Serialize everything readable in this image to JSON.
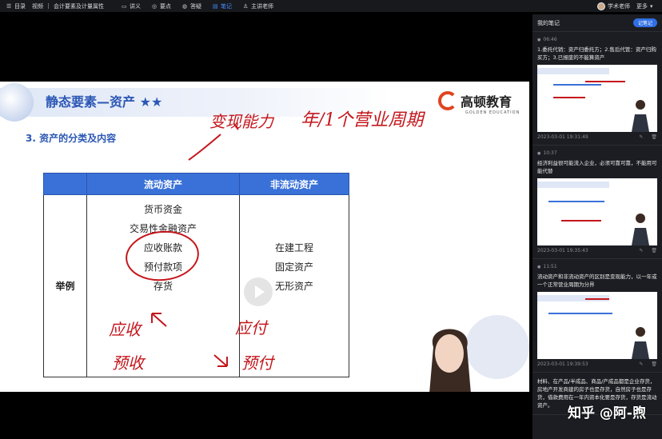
{
  "topbar": {
    "menu": "目录",
    "course": "视频",
    "chapter": "会计要素及计量属性",
    "tabs": [
      "讲义",
      "要点",
      "答疑",
      "笔记",
      "主讲老师"
    ],
    "teacher": "学术老师",
    "more": "更多"
  },
  "slide": {
    "title": "静态要素—资产",
    "stars": "★★",
    "logo": "高顿教育",
    "logo_sub": "GOLDEN EDUCATION",
    "subtitle": "3.   资产的分类及内容",
    "col1": "流动资产",
    "col2": "非流动资产",
    "row_label": "举例",
    "current_assets": [
      "货币资金",
      "交易性金融资产",
      "应收账款",
      "预付款项",
      "存货"
    ],
    "noncurrent_assets": [
      "在建工程",
      "固定资产",
      "无形资产"
    ]
  },
  "handwriting": {
    "top_left": "变现能力",
    "top_right": "年/1个营业周期",
    "bottom_1": "应收",
    "bottom_2": "应付",
    "bottom_3": "预收",
    "bottom_4": "预付"
  },
  "notes": {
    "title": "我的笔记",
    "button": "记笔记",
    "items": [
      {
        "time": "06:46",
        "text": "1.委托代销：资产归委托方；2.售后代管：资产归购买方；3.已报废的不能算资产",
        "date": "2023-03-01 19:31:49"
      },
      {
        "time": "10:37",
        "text": "经济利益很可能流入企业，必须可靠可靠，不能用可能代替",
        "date": "2023-03-01 19:35:43"
      },
      {
        "time": "11:51",
        "text": "流动资产和非流动资产的区别是变现能力，以一年或一个正常营业周期为分界",
        "date": "2023-03-01 19:39:53"
      },
      {
        "time": "",
        "text": "材料、在产品/半成品、商品/产成品都是企业存货，房地产开发商建的房子也是存货，自然房子也是存货，借款费用在一年内资本化要是存货，存货是流动资产。",
        "date": ""
      }
    ]
  },
  "watermark": "知乎 @阿-煦",
  "colors": {
    "accent": "#2f6fe4",
    "slide_blue": "#2b57b5",
    "table_head": "#3a71d8",
    "ink_red": "#c4161c"
  }
}
